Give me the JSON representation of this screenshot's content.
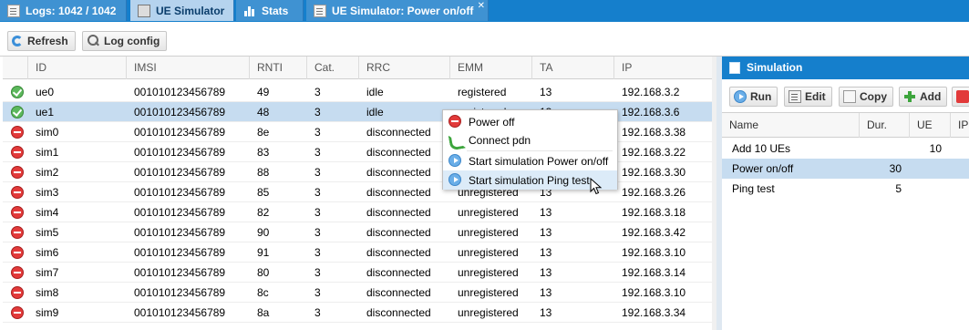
{
  "tabs": [
    {
      "label": "Logs: 1042 / 1042",
      "icon": "document-icon",
      "active": false
    },
    {
      "label": "UE Simulator",
      "icon": "calculator-icon",
      "active": true
    },
    {
      "label": "Stats",
      "icon": "bar-chart-icon",
      "active": false
    },
    {
      "label": "UE Simulator: Power on/off",
      "icon": "document-icon",
      "active": false,
      "closable": true,
      "close_label": "✕"
    }
  ],
  "toolbar": {
    "refresh_label": "Refresh",
    "log_config_label": "Log config"
  },
  "ue_grid": {
    "columns": [
      "ID",
      "IMSI",
      "RNTI",
      "Cat.",
      "RRC",
      "EMM",
      "TA",
      "IP"
    ],
    "rows": [
      {
        "status": "ok",
        "id": "ue0",
        "imsi": "001010123456789",
        "rnti": "49",
        "cat": "3",
        "rrc": "idle",
        "emm": "registered",
        "ta": "13",
        "ip": "192.168.3.2"
      },
      {
        "status": "ok",
        "id": "ue1",
        "imsi": "001010123456789",
        "rnti": "48",
        "cat": "3",
        "rrc": "idle",
        "emm": "registered",
        "ta": "13",
        "ip": "192.168.3.6"
      },
      {
        "status": "off",
        "id": "sim0",
        "imsi": "001010123456789",
        "rnti": "8e",
        "cat": "3",
        "rrc": "disconnected",
        "emm": "unregistered",
        "ta": "13",
        "ip": "192.168.3.38"
      },
      {
        "status": "off",
        "id": "sim1",
        "imsi": "001010123456789",
        "rnti": "83",
        "cat": "3",
        "rrc": "disconnected",
        "emm": "unregistered",
        "ta": "13",
        "ip": "192.168.3.22"
      },
      {
        "status": "off",
        "id": "sim2",
        "imsi": "001010123456789",
        "rnti": "88",
        "cat": "3",
        "rrc": "disconnected",
        "emm": "unregistered",
        "ta": "13",
        "ip": "192.168.3.30"
      },
      {
        "status": "off",
        "id": "sim3",
        "imsi": "001010123456789",
        "rnti": "85",
        "cat": "3",
        "rrc": "disconnected",
        "emm": "unregistered",
        "ta": "13",
        "ip": "192.168.3.26"
      },
      {
        "status": "off",
        "id": "sim4",
        "imsi": "001010123456789",
        "rnti": "82",
        "cat": "3",
        "rrc": "disconnected",
        "emm": "unregistered",
        "ta": "13",
        "ip": "192.168.3.18"
      },
      {
        "status": "off",
        "id": "sim5",
        "imsi": "001010123456789",
        "rnti": "90",
        "cat": "3",
        "rrc": "disconnected",
        "emm": "unregistered",
        "ta": "13",
        "ip": "192.168.3.42"
      },
      {
        "status": "off",
        "id": "sim6",
        "imsi": "001010123456789",
        "rnti": "91",
        "cat": "3",
        "rrc": "disconnected",
        "emm": "unregistered",
        "ta": "13",
        "ip": "192.168.3.10"
      },
      {
        "status": "off",
        "id": "sim7",
        "imsi": "001010123456789",
        "rnti": "80",
        "cat": "3",
        "rrc": "disconnected",
        "emm": "unregistered",
        "ta": "13",
        "ip": "192.168.3.14"
      },
      {
        "status": "off",
        "id": "sim8",
        "imsi": "001010123456789",
        "rnti": "8c",
        "cat": "3",
        "rrc": "disconnected",
        "emm": "unregistered",
        "ta": "13",
        "ip": "192.168.3.10"
      },
      {
        "status": "off",
        "id": "sim9",
        "imsi": "001010123456789",
        "rnti": "8a",
        "cat": "3",
        "rrc": "disconnected",
        "emm": "unregistered",
        "ta": "13",
        "ip": "192.168.3.34"
      }
    ],
    "selected_row": 1
  },
  "context_menu": {
    "items": [
      {
        "label": "Power off",
        "icon": "stop-icon"
      },
      {
        "label": "Connect pdn",
        "icon": "phone-icon"
      },
      {
        "label": "Start simulation Power on/off",
        "icon": "play-icon"
      },
      {
        "label": "Start simulation Ping test",
        "icon": "play-icon"
      }
    ],
    "hovered_item": 3
  },
  "simulation_panel": {
    "title": "Simulation",
    "buttons": {
      "run": "Run",
      "edit": "Edit",
      "copy": "Copy",
      "add": "Add"
    },
    "columns": [
      "Name",
      "Dur.",
      "UE",
      "IP"
    ],
    "rows": [
      {
        "name": "Add 10 UEs",
        "dur": "",
        "ue": "10"
      },
      {
        "name": "Power on/off",
        "dur": "30",
        "ue": ""
      },
      {
        "name": "Ping test",
        "dur": "5",
        "ue": ""
      }
    ],
    "selected_row": 1
  },
  "colors": {
    "header_blue": "#157fcc",
    "selection": "#c6dcf0",
    "status_ok": "#5cb85c",
    "status_off": "#e23a3a"
  }
}
